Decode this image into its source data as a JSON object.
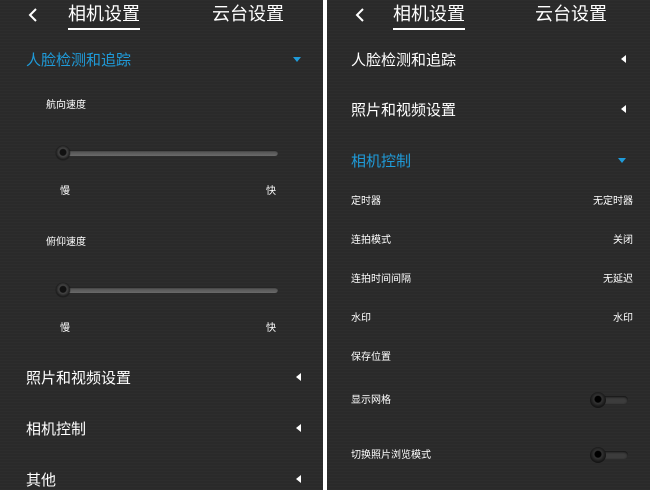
{
  "left": {
    "tabs": {
      "camera": "相机设置",
      "gimbal": "云台设置"
    },
    "face_section": {
      "label": "人脸检测和追踪"
    },
    "pan_speed": {
      "label": "航向速度",
      "slow": "慢",
      "fast": "快",
      "value": 0.0
    },
    "tilt_speed": {
      "label": "俯仰速度",
      "slow": "慢",
      "fast": "快",
      "value": 0.0
    },
    "sections": [
      {
        "label": "照片和视频设置"
      },
      {
        "label": "相机控制"
      },
      {
        "label": "其他"
      }
    ]
  },
  "right": {
    "tabs": {
      "camera": "相机设置",
      "gimbal": "云台设置"
    },
    "sections": [
      {
        "label": "人脸检测和追踪"
      },
      {
        "label": "照片和视频设置"
      },
      {
        "label": "相机控制"
      }
    ],
    "rows": [
      {
        "label": "定时器",
        "value": "无定时器"
      },
      {
        "label": "连拍模式",
        "value": "关闭"
      },
      {
        "label": "连拍时间间隔",
        "value": "无延迟"
      },
      {
        "label": "水印",
        "value": "水印"
      },
      {
        "label": "保存位置",
        "value": ""
      }
    ],
    "toggles": [
      {
        "label": "显示网格",
        "on": false
      },
      {
        "label": "切换照片浏览模式",
        "on": false
      }
    ]
  },
  "colors": {
    "accent": "#1f9bd9",
    "background": "#2a2a2a",
    "text": "#ffffff"
  }
}
